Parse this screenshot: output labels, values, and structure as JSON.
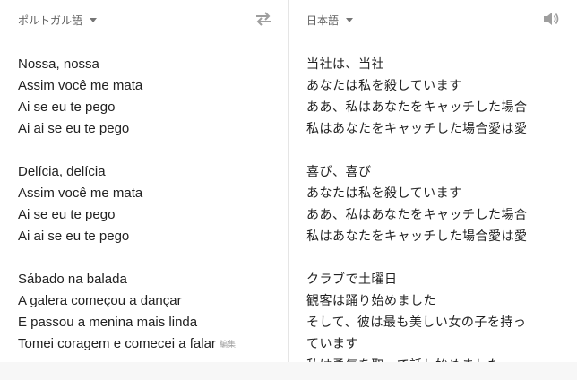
{
  "header": {
    "source_language": "ポルトガル語",
    "target_language": "日本語",
    "swap_icon": "swap-horiz-icon",
    "speaker_icon": "volume-icon"
  },
  "source": {
    "stanzas": [
      [
        "Nossa, nossa",
        "Assim você me mata",
        "Ai se eu te pego",
        "Ai ai se eu te pego"
      ],
      [
        "Delícia, delícia",
        "Assim você me mata",
        "Ai se eu te pego",
        "Ai ai se eu te pego"
      ],
      [
        "Sábado na balada",
        "A galera começou a dançar",
        "E passou a menina mais linda",
        "Tomei coragem e comecei a falar"
      ]
    ],
    "edit_label": "編集"
  },
  "target": {
    "stanzas": [
      [
        "当社は、当社",
        "あなたは私を殺しています",
        "ああ、私はあなたをキャッチした場合",
        "私はあなたをキャッチした場合愛は愛"
      ],
      [
        "喜び、喜び",
        "あなたは私を殺しています",
        "ああ、私はあなたをキャッチした場合",
        "私はあなたをキャッチした場合愛は愛"
      ],
      [
        "クラブで土曜日",
        "観客は踊り始めました",
        "そして、彼は最も美しい女の子を持っ",
        "ています",
        "私は勇気を取って話し始めました"
      ]
    ]
  }
}
